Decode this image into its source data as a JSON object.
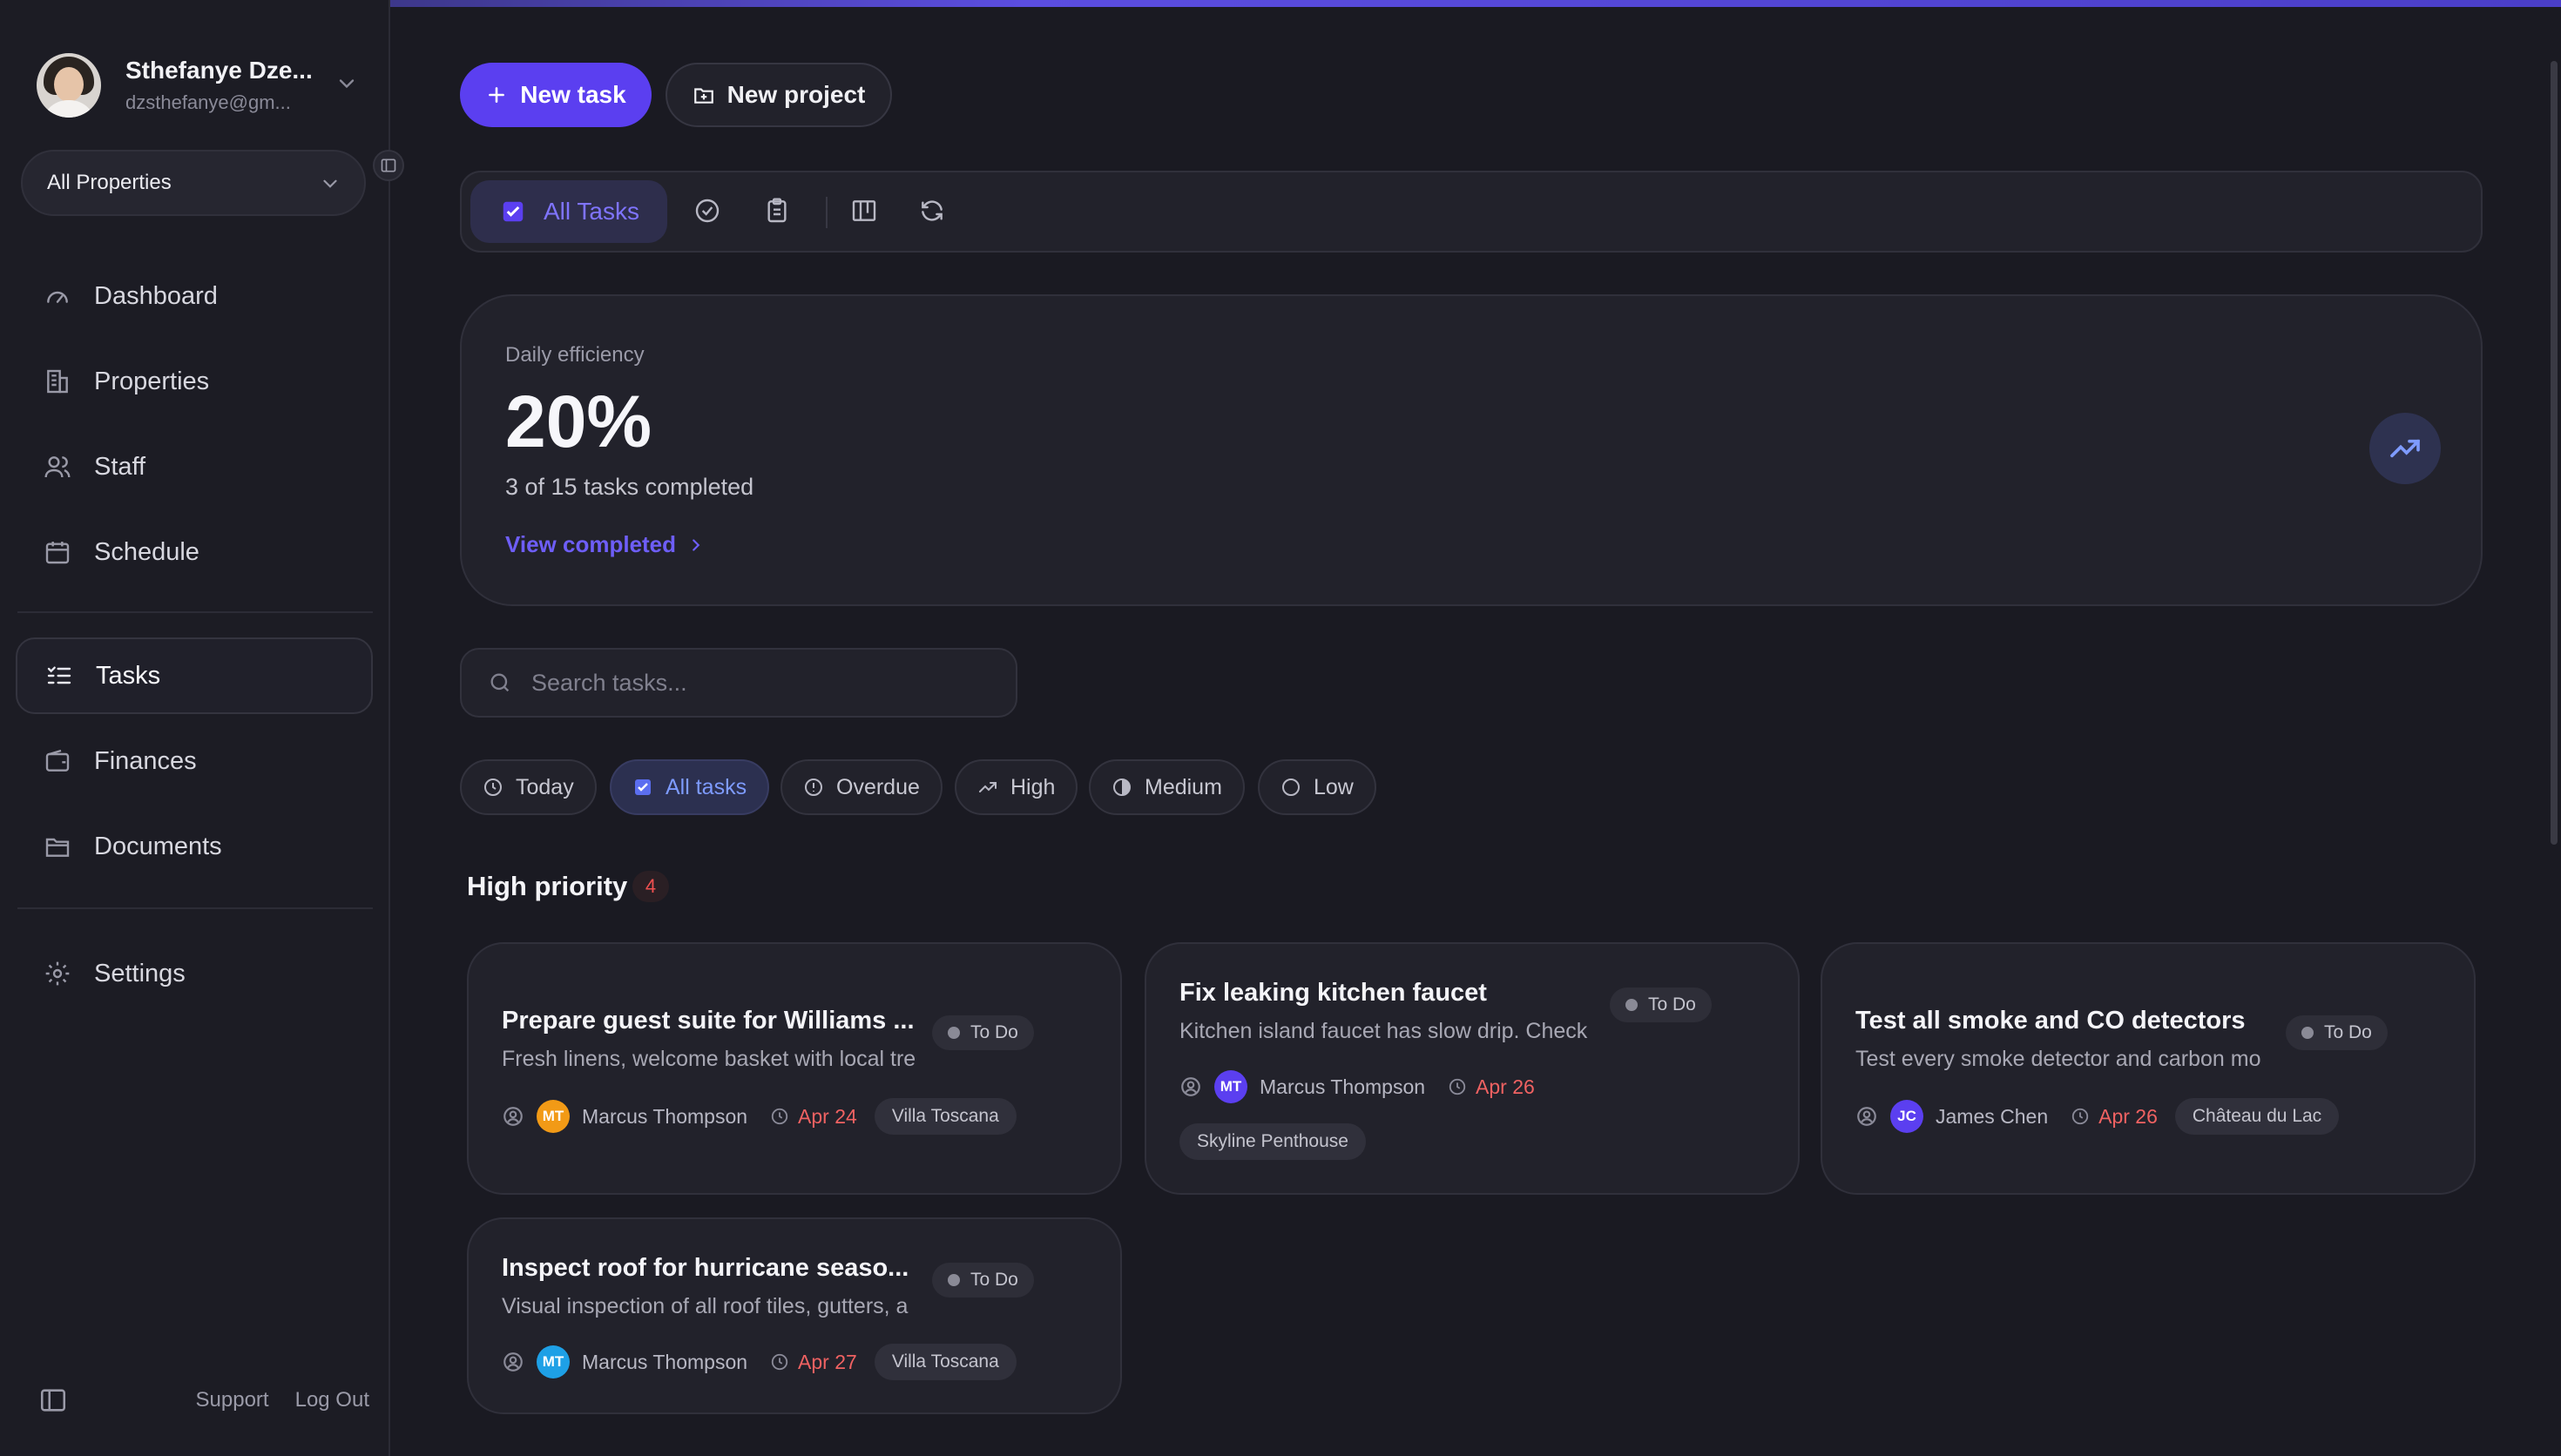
{
  "user": {
    "name": "Sthefanye Dze...",
    "email": "dzsthefanye@gm..."
  },
  "property_select": {
    "value": "All Properties"
  },
  "nav": [
    {
      "label": "Dashboard",
      "icon": "gauge-icon"
    },
    {
      "label": "Properties",
      "icon": "building-icon"
    },
    {
      "label": "Staff",
      "icon": "users-icon"
    },
    {
      "label": "Schedule",
      "icon": "calendar-icon"
    },
    {
      "label": "Tasks",
      "icon": "list-check-icon",
      "active": true
    },
    {
      "label": "Finances",
      "icon": "wallet-icon"
    },
    {
      "label": "Documents",
      "icon": "folder-icon"
    },
    {
      "label": "Settings",
      "icon": "gear-icon"
    }
  ],
  "footer": {
    "support": "Support",
    "logout": "Log Out"
  },
  "actions": {
    "new_task": "New task",
    "new_project": "New project"
  },
  "view_bar": {
    "all_tasks": "All Tasks"
  },
  "efficiency": {
    "label": "Daily efficiency",
    "value": "20%",
    "summary": "3 of 15 tasks completed",
    "link": "View completed"
  },
  "search": {
    "placeholder": "Search tasks..."
  },
  "filters": [
    "Today",
    "All tasks",
    "Overdue",
    "High",
    "Medium",
    "Low"
  ],
  "active_filter": "All tasks",
  "section": {
    "title": "High priority",
    "count": "4"
  },
  "tasks": [
    {
      "title": "Prepare guest suite for Williams ...",
      "desc": "Fresh linens, welcome basket with local tre",
      "status": "To Do",
      "assignee": "Marcus Thompson",
      "initials": "MT",
      "avatar_color": "#f29a16",
      "due": "Apr 24",
      "property": "Villa Toscana"
    },
    {
      "title": "Fix leaking kitchen faucet",
      "desc": "Kitchen island faucet has slow drip. Check",
      "status": "To Do",
      "assignee": "Marcus Thompson",
      "initials": "MT",
      "avatar_color": "#5b3ff0",
      "due": "Apr 26",
      "property": "Skyline Penthouse"
    },
    {
      "title": "Test all smoke and CO detectors",
      "desc": "Test every smoke detector and carbon mo",
      "status": "To Do",
      "assignee": "James Chen",
      "initials": "JC",
      "avatar_color": "#5b3ff0",
      "due": "Apr 26",
      "property": "Château du Lac"
    },
    {
      "title": "Inspect roof for hurricane seaso...",
      "desc": "Visual inspection of all roof tiles, gutters, a",
      "status": "To Do",
      "assignee": "Marcus Thompson",
      "initials": "MT",
      "avatar_color": "#1ea0e6",
      "due": "Apr 27",
      "property": "Villa Toscana"
    }
  ],
  "colors": {
    "accent": "#5b3ff0",
    "danger": "#f06262",
    "background": "#1a1a22",
    "card": "#22222b"
  }
}
